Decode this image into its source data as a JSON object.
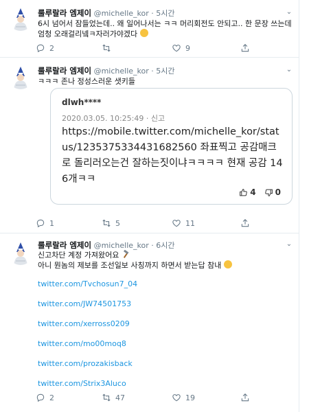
{
  "tweets": [
    {
      "name": "룰루랄라 엠제이",
      "handle": "@michelle_kor",
      "sep": "·",
      "time": "5시간",
      "text": "6시 넘어서 잠들었는데.. 왜 일어나서는 ㅋㅋ 머리회전도 안되고.. 한 문장 쓰는데 엄청 오래걸리넼ㅋ자러가야겠다",
      "replies": "2",
      "retweets": "",
      "likes": "9"
    },
    {
      "name": "룰루랄라 엠제이",
      "handle": "@michelle_kor",
      "sep": "·",
      "time": "5시간",
      "text": "ㅋㅋㅋ 존나 정성스러운 샛키들",
      "card": {
        "user": "dlwh****",
        "datetime": "2020.03.05. 10:25:49 · 신고",
        "text": "https://mobile.twitter.com/michelle_kor/status/1235375334431682560 좌표찍고 공감매크로 돌리러오는건 잘하는짓이냐ㅋㅋㅋㅋ 현재 공감 146개ㅋㅋ",
        "up": "4",
        "down": "0"
      },
      "replies": "1",
      "retweets": "5",
      "likes": "11"
    },
    {
      "name": "룰루랄라 엠제이",
      "handle": "@michelle_kor",
      "sep": "·",
      "time": "6시간",
      "text1": "신고차단 계정 가져왔어요",
      "text2": "아니 뭔놈의 제보를 조선일보 사칭까지 하면서 받는답 참내",
      "links": [
        "twitter.com/Tvchosun7_04",
        "twitter.com/JW74501753",
        "twitter.com/xerross0209",
        "twitter.com/mo00moq8",
        "twitter.com/prozakisback",
        "twitter.com/Strix3Aluco"
      ],
      "replies": "2",
      "retweets": "47",
      "likes": "19"
    }
  ],
  "icons": {
    "reply": "reply-icon",
    "retweet": "retweet-icon",
    "like": "heart-icon",
    "share": "share-icon",
    "more": "chevron-down-icon"
  },
  "colors": {
    "link": "#1b95e0",
    "meta": "#657786",
    "divider": "#e6ecf0"
  }
}
